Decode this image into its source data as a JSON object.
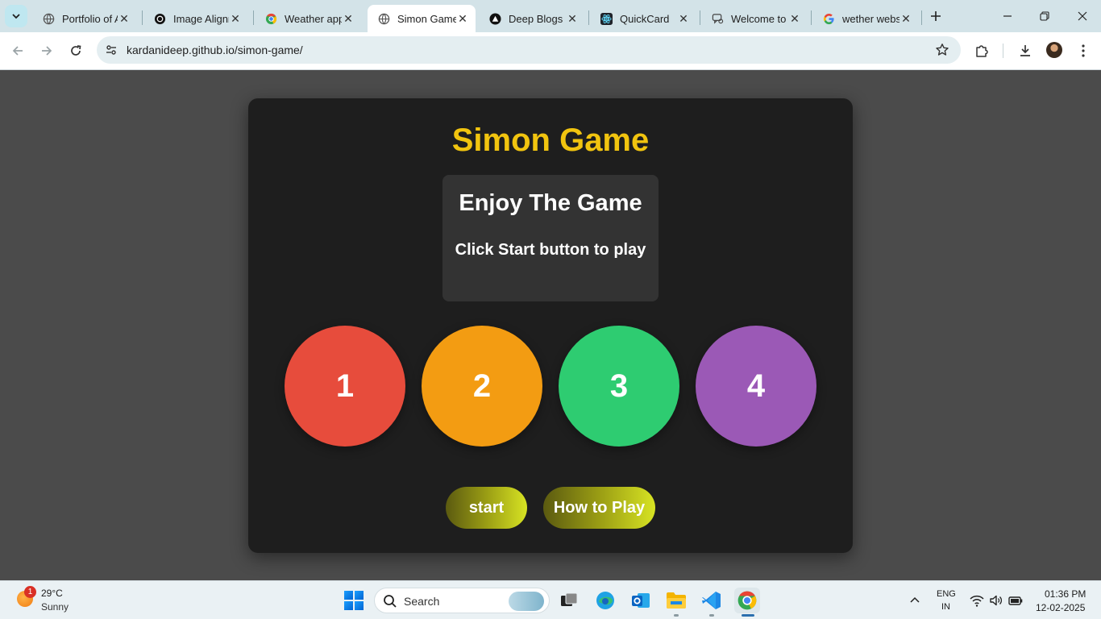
{
  "browser": {
    "tabs": [
      {
        "title": "Portfolio of A",
        "icon": "globe-icon",
        "active": false
      },
      {
        "title": "Image Alignm",
        "icon": "openai-icon",
        "active": false
      },
      {
        "title": "Weather app",
        "icon": "chrome-icon",
        "active": false
      },
      {
        "title": "Simon Game",
        "icon": "globe-icon",
        "active": true
      },
      {
        "title": "Deep Blogs",
        "icon": "triangle-logo-icon",
        "active": false
      },
      {
        "title": "QuickCard",
        "icon": "react-icon",
        "active": false
      },
      {
        "title": "Welcome to",
        "icon": "chat-icon",
        "active": false
      },
      {
        "title": "wether webs",
        "icon": "google-icon",
        "active": false
      }
    ],
    "url": "kardanideep.github.io/simon-game/"
  },
  "game": {
    "title": "Simon Game",
    "status_heading": "Enjoy The Game",
    "status_text": "Click Start button to play",
    "buttons": [
      {
        "label": "1",
        "color": "#e74c3c"
      },
      {
        "label": "2",
        "color": "#f39c12"
      },
      {
        "label": "3",
        "color": "#2ecc71"
      },
      {
        "label": "4",
        "color": "#9b59b6"
      }
    ],
    "start_label": "start",
    "howto_label": "How to Play",
    "title_color": "#f1c40f"
  },
  "taskbar": {
    "weather_temp": "29°C",
    "weather_desc": "Sunny",
    "weather_badge": "1",
    "search_label": "Search",
    "lang_top": "ENG",
    "lang_bottom": "IN",
    "time": "01:36 PM",
    "date": "12-02-2025"
  }
}
